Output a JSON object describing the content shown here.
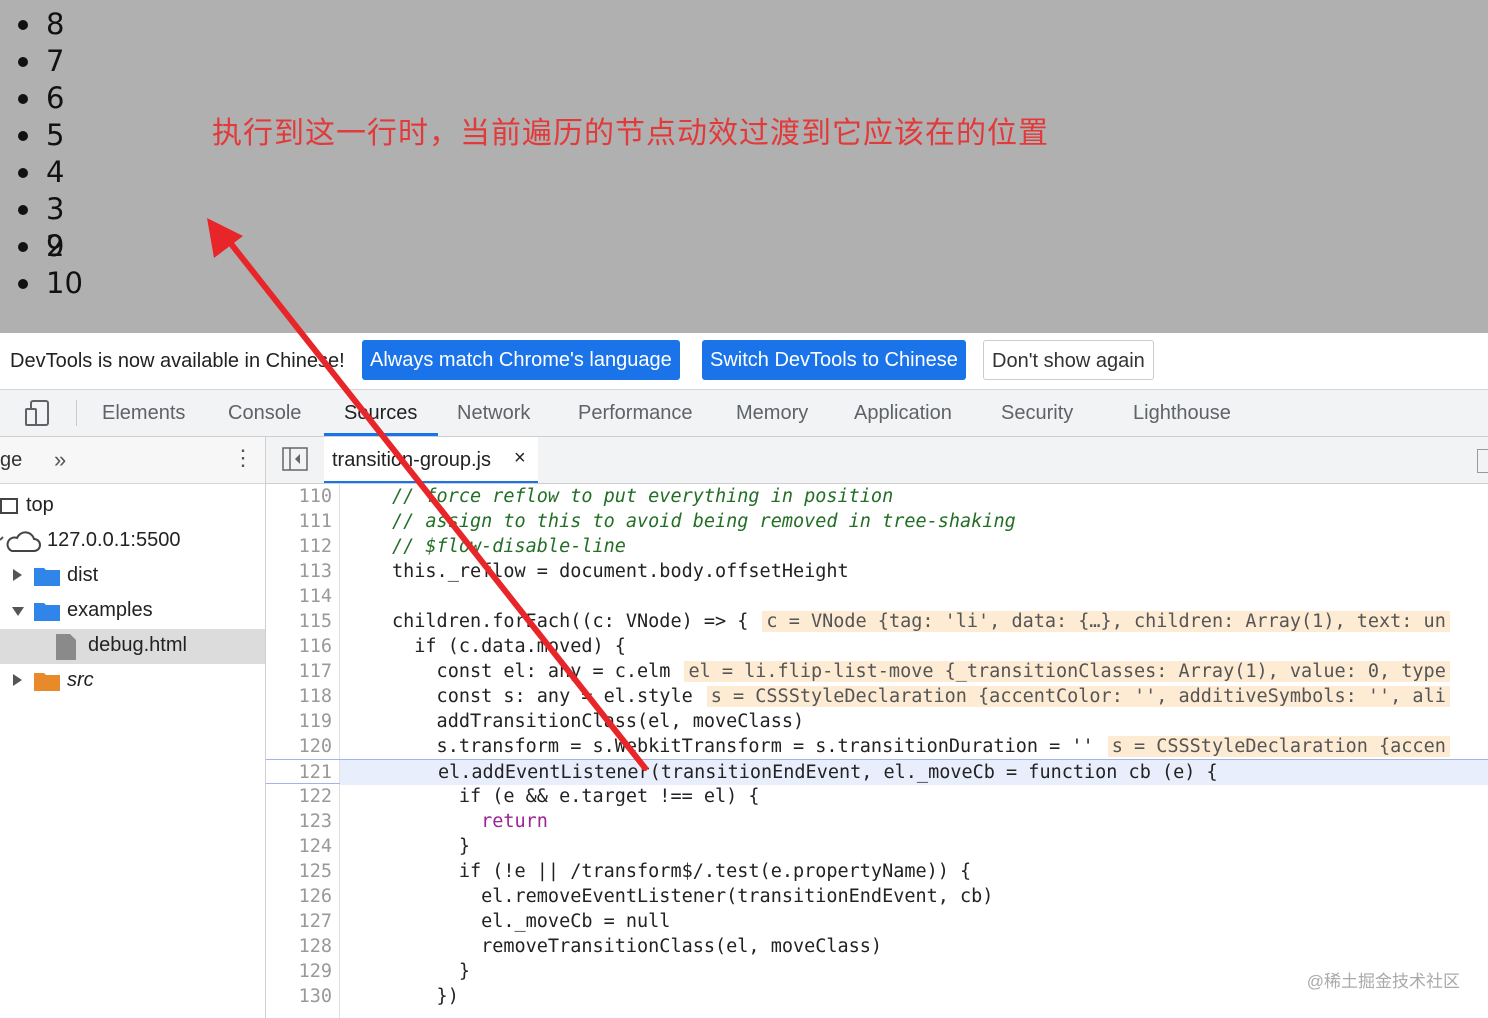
{
  "preview": {
    "list_items": [
      "8",
      "7",
      "6",
      "5",
      "4",
      "3",
      "9",
      "10"
    ],
    "overlapped_item_under": "2",
    "annotation": "执行到这一行时，当前遍历的节点动效过渡到它应该在的位置",
    "annotation_color": "#e23a3a",
    "background_color": "#b0b0b0"
  },
  "infobar": {
    "message": "DevTools is now available in Chinese!",
    "btn_match_language": "Always match Chrome's language",
    "btn_switch": "Switch DevTools to Chinese",
    "btn_dont_show": "Don't show again",
    "accent_color": "#1a73e8"
  },
  "main_tabs": {
    "elements": "Elements",
    "console": "Console",
    "sources": "Sources",
    "network": "Network",
    "performance": "Performance",
    "memory": "Memory",
    "application": "Application",
    "security": "Security",
    "lighthouse": "Lighthouse",
    "active": "Sources"
  },
  "navigator": {
    "header_label": "ge",
    "more_icon": "chevron-double-right-icon",
    "tree": {
      "top": "top",
      "host": "127.0.0.1:5500",
      "dist": "dist",
      "examples": "examples",
      "debug_html": "debug.html",
      "src": "src"
    }
  },
  "editor": {
    "file_tab": "transition-group.js",
    "close_glyph": "×",
    "current_line": 121,
    "lines": [
      {
        "n": "110"
      },
      {
        "n": "111"
      },
      {
        "n": "112"
      },
      {
        "n": "113"
      },
      {
        "n": "114"
      },
      {
        "n": "115"
      },
      {
        "n": "116"
      },
      {
        "n": "117"
      },
      {
        "n": "118"
      },
      {
        "n": "119"
      },
      {
        "n": "120"
      },
      {
        "n": "121"
      },
      {
        "n": "122"
      },
      {
        "n": "123"
      },
      {
        "n": "124"
      },
      {
        "n": "125"
      },
      {
        "n": "126"
      },
      {
        "n": "127"
      },
      {
        "n": "128"
      },
      {
        "n": "129"
      },
      {
        "n": "130"
      }
    ],
    "code": {
      "l110": "// force reflow to put everything in position",
      "l111": "// assign to this to avoid being removed in tree-shaking",
      "l112": "// $flow-disable-line",
      "l113": "this._reflow = document.body.offsetHeight",
      "l115": "children.forEach((c: VNode) => {",
      "l115_inline": "c = VNode {tag: 'li', data: {…}, children: Array(1), text: un",
      "l116": "  if (c.data.moved) {",
      "l117": "    const el: any = c.elm",
      "l117_inline": "el = li.flip-list-move {_transitionClasses: Array(1), value: 0, type",
      "l118": "    const s: any = el.style",
      "l118_inline": "s = CSSStyleDeclaration {accentColor: '', additiveSymbols: '', ali",
      "l119": "    addTransitionClass(el, moveClass)",
      "l120": "    s.transform = s.WebkitTransform = s.transitionDuration = ''",
      "l120_inline": "s = CSSStyleDeclaration {accen",
      "l121": "el.addEventListener(transitionEndEvent, el._moveCb = function cb (e) {",
      "l122": "      if (e && e.target !== el) {",
      "l123": "        return",
      "l124": "      }",
      "l125": "      if (!e || /transform$/.test(e.propertyName)) {",
      "l126": "        el.removeEventListener(transitionEndEvent, cb)",
      "l127": "        el._moveCb = null",
      "l128": "        removeTransitionClass(el, moveClass)",
      "l129": "      }",
      "l130": "    })"
    }
  },
  "watermark": "@稀土掘金技术社区",
  "arrow_color": "#e8262a"
}
